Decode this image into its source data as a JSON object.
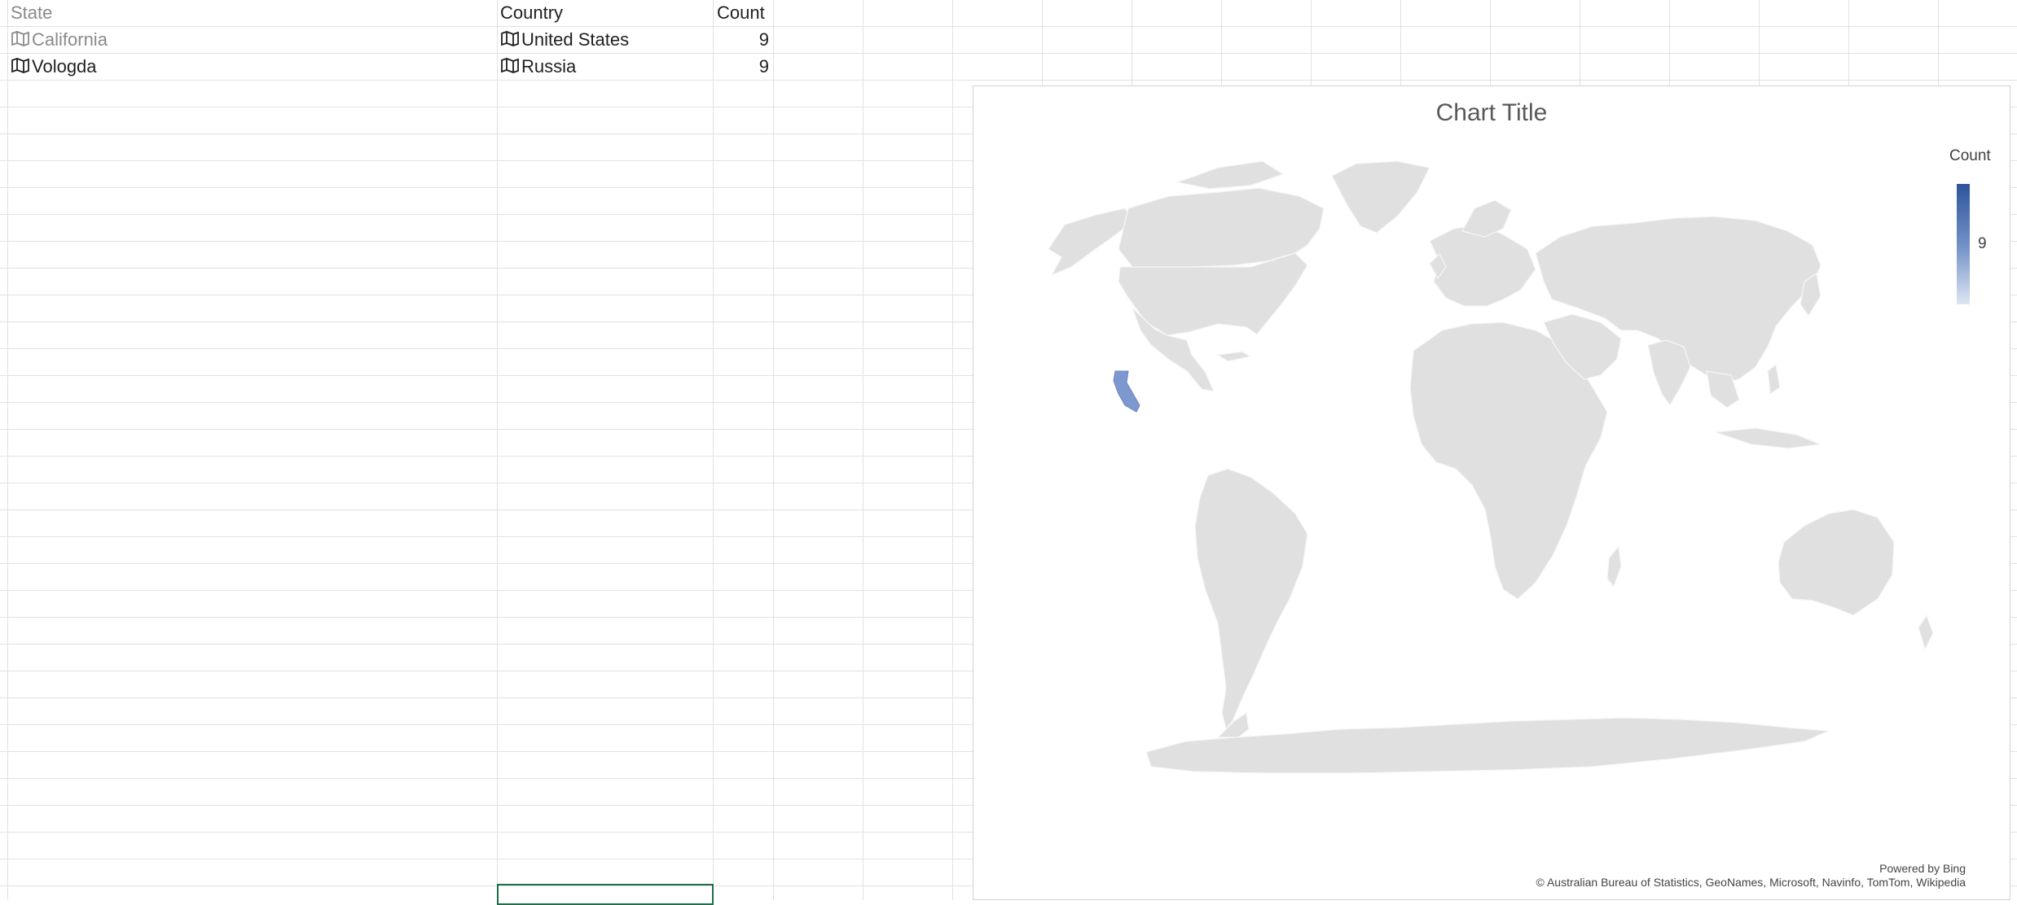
{
  "sheet": {
    "headers": {
      "state": "State",
      "country": "Country",
      "count": "Count"
    },
    "rows": [
      {
        "state": "California",
        "country": "United States",
        "count": "9"
      },
      {
        "state": "Vologda",
        "country": "Russia",
        "count": "9"
      }
    ]
  },
  "chart": {
    "title": "Chart Title",
    "legend": {
      "title": "Count",
      "value": "9",
      "color_high": "#2e559a",
      "color_low": "#dde5f3"
    },
    "region_color": "#7d98cf",
    "land_color": "#e0e0e0",
    "powered_by": "Powered by Bing",
    "copyright": "© Australian Bureau of Statistics, GeoNames, Microsoft, Navinfo, TomTom, Wikipedia"
  },
  "chart_data": {
    "type": "map",
    "title": "Chart Title",
    "legend_title": "Count",
    "regions": [
      {
        "state": "California",
        "country": "United States",
        "value": 9
      },
      {
        "state": "Vologda",
        "country": "Russia",
        "value": 9
      }
    ]
  }
}
